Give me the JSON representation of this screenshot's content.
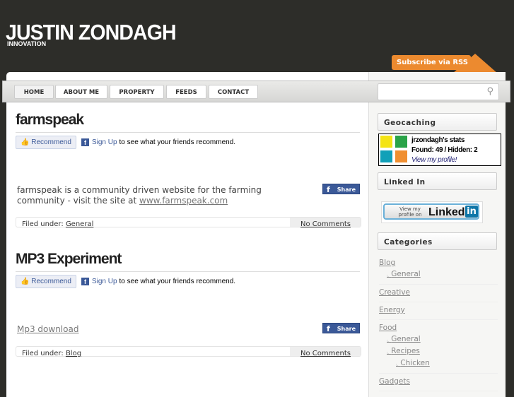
{
  "site": {
    "title": "JUSTIN ZONDAGH",
    "tagline": "INNOVATION",
    "rss": "Subscribe via RSS"
  },
  "nav": [
    "HOME",
    "ABOUT ME",
    "PROPERTY",
    "FEEDS",
    "CONTACT"
  ],
  "fb": {
    "recommend": "Recommend",
    "signup": "Sign Up",
    "signup_text": "to see what your friends recommend.",
    "share": "Share",
    "f": "f"
  },
  "posts": [
    {
      "title": "farmspeak",
      "body": "farmspeak is a community driven website for the farming community - visit the site at ",
      "link": "www.farmspeak.com",
      "filed": "Filed under:",
      "category": "General",
      "comments": "No Comments"
    },
    {
      "title": "MP3 Experiment",
      "link": "Mp3 download",
      "filed": "Filed under:",
      "category": "Blog",
      "comments": "No Comments"
    }
  ],
  "sidebar": {
    "geocaching": {
      "title": "Geocaching",
      "stats": "jrzondagh's stats",
      "found": "Found: 49 / Hidden: 2",
      "profile": "View my profile!"
    },
    "linkedin": {
      "title": "Linked In",
      "small": "View my profile on",
      "big": "Linked",
      "in": "in"
    },
    "categories": {
      "title": "Categories",
      "items": [
        "Blog",
        "General",
        "Creative",
        "Energy",
        "Food",
        "General",
        "Recipes",
        "Chicken",
        "Gadgets"
      ]
    }
  }
}
